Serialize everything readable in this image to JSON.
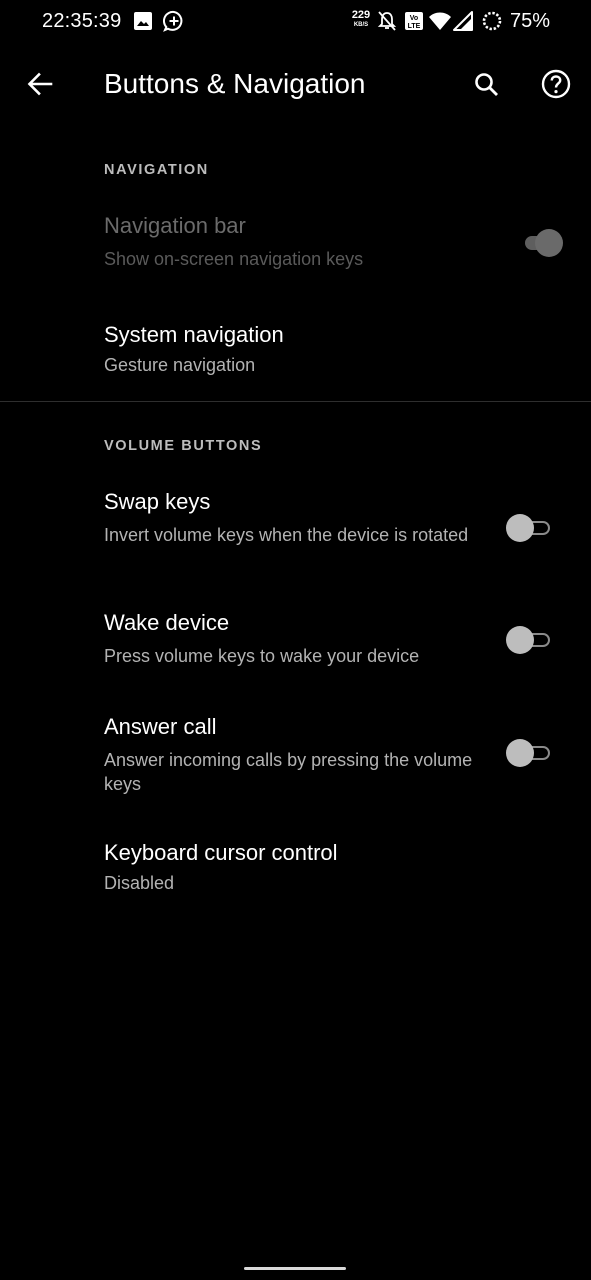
{
  "status_bar": {
    "time": "22:35:39",
    "net_speed_value": "229",
    "net_speed_unit": "KB/S",
    "battery": "75%",
    "icons": [
      "image-icon",
      "chat-add-icon",
      "notifications-off-icon",
      "volte-icon",
      "wifi-icon",
      "signal-icon",
      "battery-saver-icon"
    ]
  },
  "app_bar": {
    "title": "Buttons & Navigation",
    "back_icon": "arrow-back-icon",
    "search_icon": "search-icon",
    "help_icon": "help-icon"
  },
  "sections": {
    "navigation": {
      "header": "NAVIGATION",
      "items": [
        {
          "title": "Navigation bar",
          "summary": "Show on-screen navigation keys",
          "toggle": "on",
          "enabled": false
        },
        {
          "title": "System navigation",
          "summary": "Gesture navigation"
        }
      ]
    },
    "volume_buttons": {
      "header": "VOLUME BUTTONS",
      "items": [
        {
          "title": "Swap keys",
          "summary": "Invert volume keys when the device is rotated",
          "toggle": "off"
        },
        {
          "title": "Wake device",
          "summary": "Press volume keys to wake your device",
          "toggle": "off"
        },
        {
          "title": "Answer call",
          "summary": "Answer incoming calls by pressing the volume keys",
          "toggle": "off"
        },
        {
          "title": "Keyboard cursor control",
          "summary": "Disabled"
        }
      ]
    }
  },
  "colors": {
    "background": "#000000",
    "text_primary": "#ffffff",
    "text_secondary": "#b3b3b3",
    "text_disabled": "#6b6b6b"
  }
}
